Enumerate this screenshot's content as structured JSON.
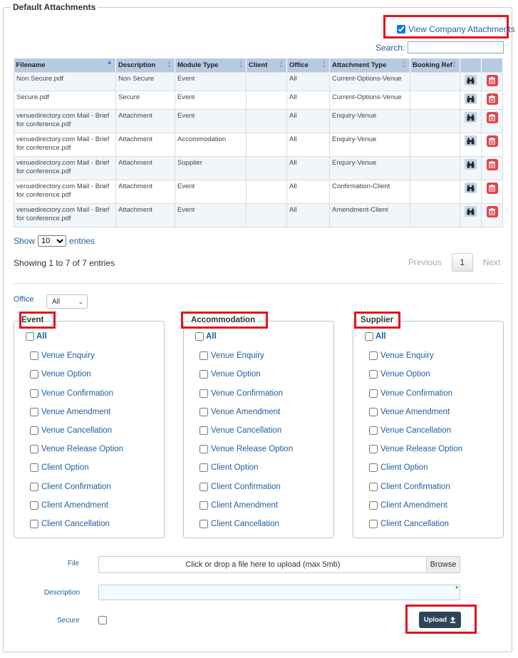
{
  "section_title": "Default Attachments",
  "view_company": {
    "label": "View Company Attachments",
    "checked": true
  },
  "search": {
    "label": "Search:",
    "value": ""
  },
  "table": {
    "headers": [
      "Filename",
      "Description",
      "Module Type",
      "Client",
      "Office",
      "Attachment Type",
      "Booking Ref"
    ],
    "rows": [
      {
        "filename": "Non Secure.pdf",
        "description": "Non Secure",
        "module": "Event",
        "client": "",
        "office": "All",
        "type": "Current-Options-Venue",
        "booking": ""
      },
      {
        "filename": "Secure.pdf",
        "description": "Secure",
        "module": "Event",
        "client": "",
        "office": "All",
        "type": "Current-Options-Venue",
        "booking": ""
      },
      {
        "filename": "venuedirectory.com Mail - Brief for conference.pdf",
        "description": "Attachment",
        "module": "Event",
        "client": "",
        "office": "All",
        "type": "Enquiry-Venue",
        "booking": ""
      },
      {
        "filename": "venuedirectory.com Mail - Brief for conference.pdf",
        "description": "Attachment",
        "module": "Accommodation",
        "client": "",
        "office": "All",
        "type": "Enquiry-Venue",
        "booking": ""
      },
      {
        "filename": "venuedirectory.com Mail - Brief for conference.pdf",
        "description": "Attachment",
        "module": "Supplier",
        "client": "",
        "office": "All",
        "type": "Enquiry-Venue",
        "booking": ""
      },
      {
        "filename": "venuedirectory.com Mail - Brief for conference.pdf",
        "description": "Attachment",
        "module": "Event",
        "client": "",
        "office": "All",
        "type": "Confirmation-Client",
        "booking": ""
      },
      {
        "filename": "venuedirectory.com Mail - Brief for conference.pdf",
        "description": "Attachment",
        "module": "Event",
        "client": "",
        "office": "All",
        "type": "Amendment-Client",
        "booking": ""
      }
    ]
  },
  "entries": {
    "show": "Show",
    "value": "10",
    "suffix": "entries",
    "info": "Showing 1 to 7 of 7 entries"
  },
  "pager": {
    "previous": "Previous",
    "page": "1",
    "next": "Next"
  },
  "office": {
    "label": "Office",
    "value": "All"
  },
  "groups": [
    {
      "title": "Event",
      "all": "All",
      "items": [
        "Venue Enquiry",
        "Venue Option",
        "Venue Confirmation",
        "Venue Amendment",
        "Venue Cancellation",
        "Venue Release Option",
        "Client Option",
        "Client Confirmation",
        "Client Amendment",
        "Client Cancellation"
      ]
    },
    {
      "title": "Accommodation",
      "all": "All",
      "items": [
        "Venue Enquiry",
        "Venue Option",
        "Venue Confirmation",
        "Venue Amendment",
        "Venue Cancellation",
        "Venue Release Option",
        "Client Option",
        "Client Confirmation",
        "Client Amendment",
        "Client Cancellation"
      ]
    },
    {
      "title": "Supplier",
      "all": "All",
      "items": [
        "Venue Enquiry",
        "Venue Option",
        "Venue Confirmation",
        "Venue Amendment",
        "Venue Cancellation",
        "Venue Release Option",
        "Client Option",
        "Client Confirmation",
        "Client Amendment",
        "Client Cancellation"
      ]
    }
  ],
  "upload_form": {
    "file_label": "File",
    "file_placeholder": "Click or drop a file here to upload (max 5mb)",
    "browse": "Browse",
    "description_label": "Description",
    "required_mark": "*",
    "secure_label": "Secure",
    "upload_button": "Upload"
  },
  "icons": {
    "view": "binoculars-icon",
    "delete": "trash-icon",
    "upload": "upload-icon"
  },
  "colors": {
    "highlight": "#e0141e",
    "link": "#1f5e9e",
    "header_bg": "#b7cbe0",
    "upload_bg": "#2f4557",
    "delete_bg": "#e0454f"
  }
}
